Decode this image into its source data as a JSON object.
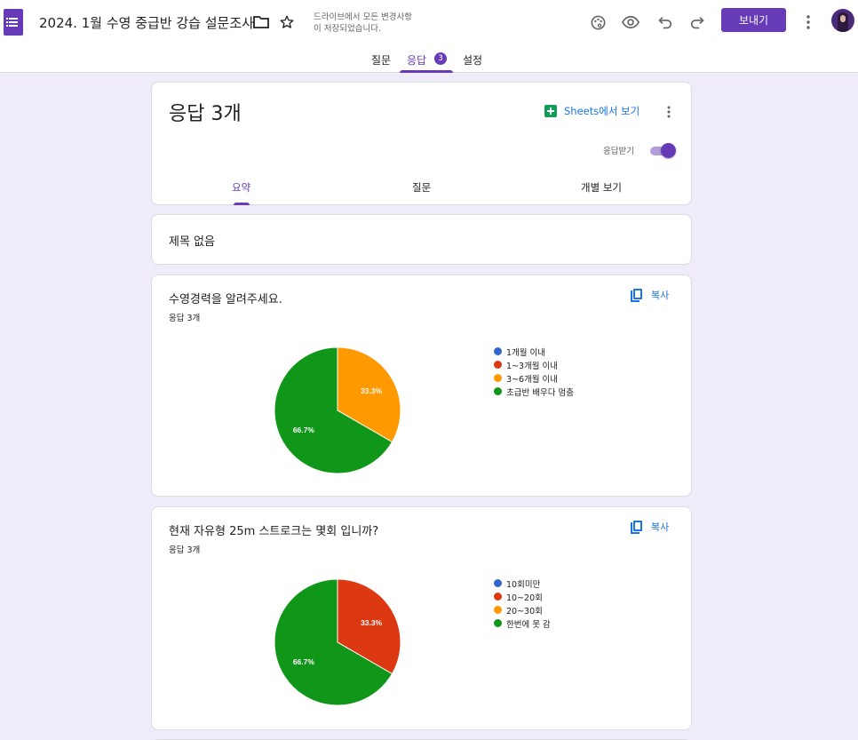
{
  "header": {
    "doc_title": "2024. 1월 수영 중급반 강습 설문조사",
    "save_status_line1": "드라이브에서 모든 변경사항",
    "save_status_line2": "이 저장되었습니다.",
    "send_label": "보내기",
    "icons": [
      "forms-app-icon",
      "folder-icon",
      "star-icon",
      "palette-icon",
      "eye-icon",
      "undo-icon",
      "redo-icon",
      "more-vert-icon",
      "avatar"
    ]
  },
  "nav": {
    "tabs": [
      {
        "label": "질문"
      },
      {
        "label": "응답",
        "badge": "3",
        "active": true
      },
      {
        "label": "설정"
      }
    ]
  },
  "responses_card": {
    "title": "응답 3개",
    "sheets_label": "Sheets에서 보기",
    "accepting_label": "응답받기",
    "accepting": true,
    "sub_tabs": [
      {
        "label": "요약",
        "active": true
      },
      {
        "label": "질문"
      },
      {
        "label": "개별 보기"
      }
    ]
  },
  "section_card": {
    "title": "제목 없음"
  },
  "copy_label": "복사",
  "colors": {
    "accent": "#673ab7",
    "blue": "#3366cc",
    "red": "#dc3912",
    "orange": "#ff9900",
    "green": "#109618"
  },
  "chart_data": [
    {
      "type": "pie",
      "title": "수영경력을 알려주세요.",
      "subtitle": "응답 3개",
      "categories": [
        "1개월 이내",
        "1~3개월 이내",
        "3~6개월 이내",
        "초급반 배우다 멈춤"
      ],
      "values": [
        0,
        0,
        1,
        2
      ],
      "slice_labels": [
        "",
        "",
        "33.3%",
        "66.7%"
      ],
      "colors": [
        "#3366cc",
        "#dc3912",
        "#ff9900",
        "#109618"
      ],
      "legend": "right"
    },
    {
      "type": "pie",
      "title": "현재 자유형 25m 스트로크는 몇회 입니까?",
      "subtitle": "응답 3개",
      "categories": [
        "10회미만",
        "10~20회",
        "20~30회",
        "한번에 못 감"
      ],
      "values": [
        0,
        1,
        0,
        2
      ],
      "slice_labels": [
        "",
        "33.3%",
        "",
        "66.7%"
      ],
      "colors": [
        "#3366cc",
        "#dc3912",
        "#ff9900",
        "#109618"
      ],
      "legend": "right"
    }
  ]
}
